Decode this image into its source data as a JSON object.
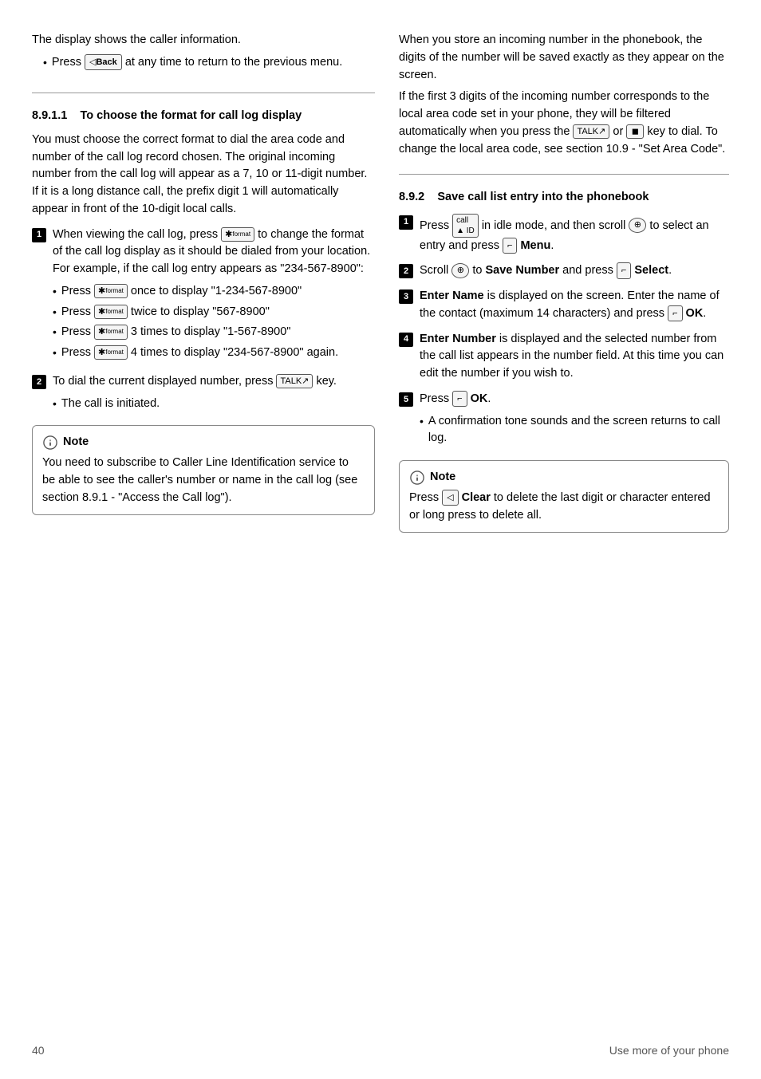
{
  "page": {
    "number": "40",
    "footer_right": "Use more of your phone"
  },
  "left_column": {
    "intro": {
      "line1": "The display shows the caller information.",
      "bullet": {
        "prefix": "Press",
        "key_label": "Back",
        "suffix": "at any time to return to the previous menu."
      }
    },
    "section_891": {
      "heading_num": "8.9.1.1",
      "heading_text": "To choose the format for call log display",
      "body1": "You must choose the correct format to dial the area code and number of the call log record chosen. The original incoming number from the call log will appear as a 7, 10 or 11-digit number. If it is a long distance call, the prefix digit 1 will automatically appear in front of the 10-digit local calls.",
      "items": [
        {
          "num": "1",
          "text": "When viewing the call log, press",
          "key": "format",
          "text2": "to change the format of the call log display as it should be dialed from your location. For example, if the call log entry appears as \"234-567-8900\":",
          "sub_bullets": [
            {
              "prefix": "Press",
              "key": "format",
              "text": "once to display \"1-234-567-8900\""
            },
            {
              "prefix": "Press",
              "key": "format",
              "text": "twice to display \"567-8900\""
            },
            {
              "prefix": "Press",
              "key": "format",
              "text": "3 times to display \"1-567-8900\""
            },
            {
              "prefix": "Press",
              "key": "format",
              "text": "4 times to display \"234-567-8900\" again."
            }
          ]
        },
        {
          "num": "2",
          "text": "To dial the current displayed number, press",
          "key": "talk",
          "text2": "key.",
          "sub_bullets": [
            {
              "text": "The call is initiated."
            }
          ]
        }
      ],
      "note": {
        "label": "Note",
        "text": "You need to subscribe to Caller Line Identification service to be able to see the caller's number or name in the call log (see section 8.9.1 - \"Access the Call log\")."
      }
    }
  },
  "right_column": {
    "intro": {
      "para1": "When you store an incoming number in the phonebook, the digits of the number will be saved exactly as they appear on the screen.",
      "para2": "If the first 3 digits of the incoming number corresponds to the local area code set in your phone, they will be filtered automatically when you press the",
      "key1": "talk",
      "middle": "or",
      "key2": "hold",
      "para3": "key to dial. To change the local area code, see section 10.9 - \"Set Area Code\"."
    },
    "section_892": {
      "heading_num": "8.9.2",
      "heading_text": "Save call list entry into the phonebook",
      "items": [
        {
          "num": "1",
          "prefix": "Press",
          "key": "callerid",
          "text": "in idle mode, and then scroll",
          "key2": "scroll",
          "text2": "to select an entry and press",
          "key3": "menu",
          "bold_label": "Menu",
          "text3": "."
        },
        {
          "num": "2",
          "prefix": "Scroll",
          "key": "scroll",
          "text": "to",
          "bold_label": "Save Number",
          "text2": "and press",
          "key2": "menu",
          "bold_label2": "Select",
          "text3": "."
        },
        {
          "num": "3",
          "bold_label": "Enter Name",
          "text": "is displayed on the screen. Enter the name of the contact (maximum 14 characters) and press",
          "key": "menu",
          "bold_label2": "OK",
          "text2": "."
        },
        {
          "num": "4",
          "bold_label": "Enter Number",
          "text": "is displayed and the selected number from the call list appears in the number field. At this time you can edit the number if you wish to."
        },
        {
          "num": "5",
          "prefix": "Press",
          "key": "menu",
          "bold_label": "OK",
          "text": ".",
          "sub_bullets": [
            {
              "text": "A confirmation tone sounds and the screen returns to call log."
            }
          ]
        }
      ],
      "note": {
        "label": "Note",
        "prefix": "Press",
        "key": "back",
        "bold_label": "Clear",
        "text": "to delete the last digit or character entered or long press to delete all."
      }
    }
  }
}
